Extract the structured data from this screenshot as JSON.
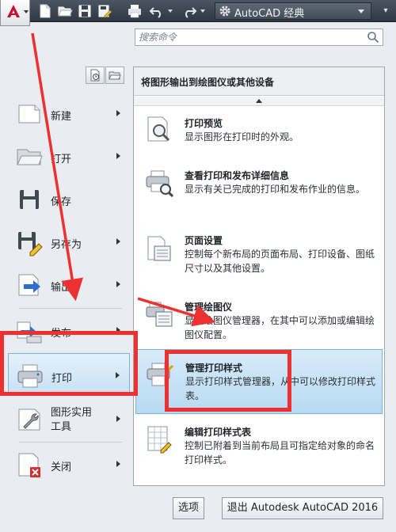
{
  "toolbar": {
    "workspace": "AutoCAD 经典"
  },
  "search": {
    "placeholder": "搜索命令"
  },
  "left_menu": {
    "items": [
      {
        "label": "新建",
        "icon": "new-file-icon"
      },
      {
        "label": "打开",
        "icon": "open-folder-icon"
      },
      {
        "label": "保存",
        "icon": "save-disk-icon"
      },
      {
        "label": "另存为",
        "icon": "save-as-icon"
      },
      {
        "label": "输出",
        "icon": "export-icon"
      },
      {
        "label": "发布",
        "icon": "publish-icon"
      },
      {
        "label": "打印",
        "icon": "print-icon"
      },
      {
        "label_line1": "图形实用",
        "label_line2": "工具",
        "icon": "drawing-utilities-icon"
      },
      {
        "label": "关闭",
        "icon": "close-document-icon"
      }
    ],
    "active": "打印"
  },
  "panel": {
    "header": "将图形输出到绘图仪或其他设备",
    "items": [
      {
        "title": "打印预览",
        "desc": "显示图形在打印时的外观。",
        "icon": "print-preview-icon"
      },
      {
        "title": "查看打印和发布详细信息",
        "desc": "显示有关已完成的打印和发布作业的信息。",
        "icon": "plot-details-icon"
      },
      {
        "title": "页面设置",
        "desc": "控制每个新布局的页面布局、打印设备、图纸尺寸以及其他设置。",
        "icon": "page-setup-icon"
      },
      {
        "title": "管理绘图仪",
        "desc": "显示绘图仪管理器，在其中可以添加或编辑绘图仪配置。",
        "icon": "plotter-manager-icon"
      },
      {
        "title": "管理打印样式",
        "desc": "显示打印样式管理器，从中可以修改打印样式表。",
        "icon": "plot-style-manager-icon"
      },
      {
        "title": "编辑打印样式表",
        "desc": "控制已附着到当前布局且可指定给对象的命名打印样式。",
        "icon": "edit-plot-style-icon"
      }
    ]
  },
  "buttons": {
    "options": "选项",
    "exit": "退出 Autodesk AutoCAD 2016"
  },
  "colors": {
    "accent_highlight": "#c7e0f4",
    "annotation": "#ee3030",
    "toolbar": "#3a424d"
  }
}
